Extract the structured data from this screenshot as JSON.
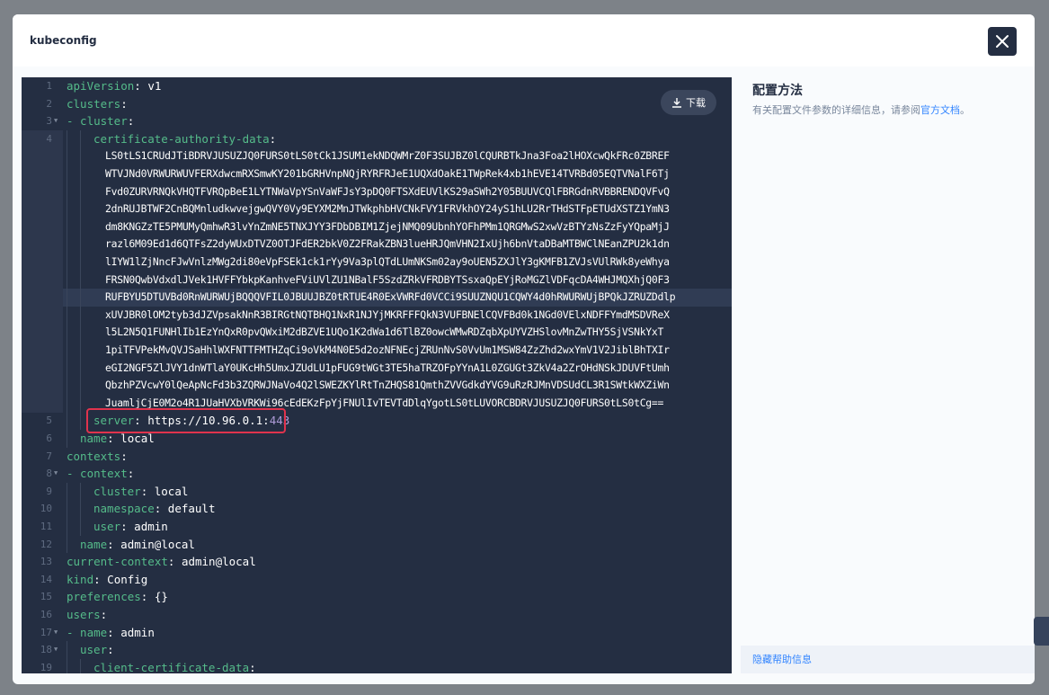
{
  "modal": {
    "title": "kubeconfig"
  },
  "editor": {
    "download_label": "下载",
    "lines": [
      {
        "n": "1",
        "fold": "",
        "indent": 0,
        "key": "apiVersion",
        "sep": ": ",
        "val": "v1"
      },
      {
        "n": "2",
        "fold": "",
        "indent": 0,
        "key": "clusters",
        "sep": ":",
        "val": ""
      },
      {
        "n": "3",
        "fold": "▼",
        "indent": 0,
        "key": "- cluster",
        "sep": ":",
        "val": ""
      },
      {
        "n": "4",
        "fold": "",
        "indent": 2,
        "key": "certificate-authority-data",
        "sep": ":",
        "val": ""
      },
      {
        "n": "5",
        "fold": "",
        "indent": 2,
        "key": "server",
        "sep": ": ",
        "val": "https://10.96.0.1:",
        "port": "443"
      },
      {
        "n": "6",
        "fold": "",
        "indent": 1,
        "key": "name",
        "sep": ": ",
        "val": "local"
      },
      {
        "n": "7",
        "fold": "",
        "indent": 0,
        "key": "contexts",
        "sep": ":",
        "val": ""
      },
      {
        "n": "8",
        "fold": "▼",
        "indent": 0,
        "key": "- context",
        "sep": ":",
        "val": ""
      },
      {
        "n": "9",
        "fold": "",
        "indent": 2,
        "key": "cluster",
        "sep": ": ",
        "val": "local"
      },
      {
        "n": "10",
        "fold": "",
        "indent": 2,
        "key": "namespace",
        "sep": ": ",
        "val": "default"
      },
      {
        "n": "11",
        "fold": "",
        "indent": 2,
        "key": "user",
        "sep": ": ",
        "val": "admin"
      },
      {
        "n": "12",
        "fold": "",
        "indent": 1,
        "key": "name",
        "sep": ": ",
        "val": "admin@local"
      },
      {
        "n": "13",
        "fold": "",
        "indent": 0,
        "key": "current-context",
        "sep": ": ",
        "val": "admin@local"
      },
      {
        "n": "14",
        "fold": "",
        "indent": 0,
        "key": "kind",
        "sep": ": ",
        "val": "Config"
      },
      {
        "n": "15",
        "fold": "",
        "indent": 0,
        "key": "preferences",
        "sep": ": ",
        "val": "{}"
      },
      {
        "n": "16",
        "fold": "",
        "indent": 0,
        "key": "users",
        "sep": ":",
        "val": ""
      },
      {
        "n": "17",
        "fold": "▼",
        "indent": 0,
        "key": "- name",
        "sep": ": ",
        "val": "admin"
      },
      {
        "n": "18",
        "fold": "▼",
        "indent": 1,
        "key": "user",
        "sep": ":",
        "val": ""
      },
      {
        "n": "19",
        "fold": "",
        "indent": 2,
        "key": "client-certificate-data",
        "sep": ":",
        "val": ""
      }
    ],
    "cert_data": [
      "LS0tLS1CRUdJTiBDRVJUSUZJQ0FURS0tLS0tCk1JSUM1ekNDQWMrZ0F3SUJBZ0lCQURBTkJna3Foa2lHOXcwQkFRc0ZBREF",
      "WTVJNd0VRWURWUVFERXdwcmRXSmwKY201bGRHVnpNQjRYRFRJeE1UQXdOakE1TWpRek4xb1hEVE14TVRBd05EQTVNalF6Tj",
      "Fvd0ZURVRNQkVHQTFVRQpBeE1LYTNWaVpYSnVaWFJsY3pDQ0FTSXdEUVlKS29aSWh2Y05BUUVCQlFBRGdnRVBBRENDQVFvQ",
      "2dnRUJBTWF2CnBQMnludkwvejgwQVY0Vy9EYXM2MnJTWkphbHVCNkFVY1FRVkhOY24yS1hLU2RrTHdSTFpETUdXSTZ1YmN3",
      "dm8KNGZzTE5PMUMyQmhwR3lvYnZmNE5TNXJYY3FDbDBIM1ZjejNMQ09UbnhYOFhPMm1QRGMwS2xwVzBTYzNsZzFyYQpaMjJ",
      "razl6M09Ed1d6QTFsZ2dyWUxDTVZ0OTJFdER2bkV0Z2FRakZBN3lueHRJQmVHN2IxUjh6bnVtaDBaMTBWClNEanZPU2k1dn",
      "lIYW1lZjNncFJwVnlzMWg2di80eVpFSEk1ck1rYy9Va3plQTdLUmNKSm02ay9oUEN5ZXJlY3gKMFB1ZVJsVUlRWk8yeWhya",
      "FRSN0QwbVdxdlJVek1HVFFYbkpKanhveFViUVlZU1NBalF5SzdZRkVFRDBYTSsxaQpEYjRoMGZlVDFqcDA4WHJMQXhjQ0F3",
      "RUFBYU5DTUVBd0RnWURWUjBQQQVFIL0JBUUJBZ0tRTUE4R0ExVWRFd0VCCi9SUUZNQU1CQWY4d0hRWURWUjBPQkJZRUZDdlp",
      "xUVJBR0lOM2tyb3dJZVpsakNnR3BIRGtNQTBHQ1NxR1NJYjMKRFFFQkN3VUFBNElCQVFBd0k1NGd0VElxNDFFYmdMSDVReX",
      "l5L2N5Q1FUNHlIb1EzYnQxR0pvQWxiM2dBZVE1UQo1K2dWa1d6TlBZ0owcWMwRDZqbXpUYVZHSlovMnZwTHY5SjVSNkYxT",
      "1piTFVPekMvQVJSaHhlWXFNTTFMTHZqCi9oVkM4N0E5d2ozNFNEcjZRUnNvS0VvUm1MSW84ZzZhd2wxYmV1V2JiblBhTXIr",
      "eGI2NGF5ZlJVY1dnWTlaY0UKcHh5UmxJZUdLU1pFUG9tWGt3TE5haTRZOFpYYnA1L0ZGUGt3ZkV4a2ZrOHdNSkJDUVFtUmh",
      "QbzhPZVcwY0lQeApNcFd3b3ZQRWJNaVo4Q2lSWEZKYlRtTnZHQS81QmthZVVGdkdYVG9uRzRJMnVDSUdCL3R1SWtkWXZiWn",
      "JuamljCjE0M2o4R1JUaHVXbVRKWi96cEdEKzFpYjFNUlIvTEVTdDlqYgotLS0tLUVORCBDRVJUSUZJQ0FURS0tLS0tCg=="
    ]
  },
  "help": {
    "title": "配置方法",
    "text_prefix": "有关配置文件参数的详细信息，请参阅",
    "link": "官方文档",
    "text_suffix": "。",
    "hide_label": "隐藏帮助信息"
  }
}
